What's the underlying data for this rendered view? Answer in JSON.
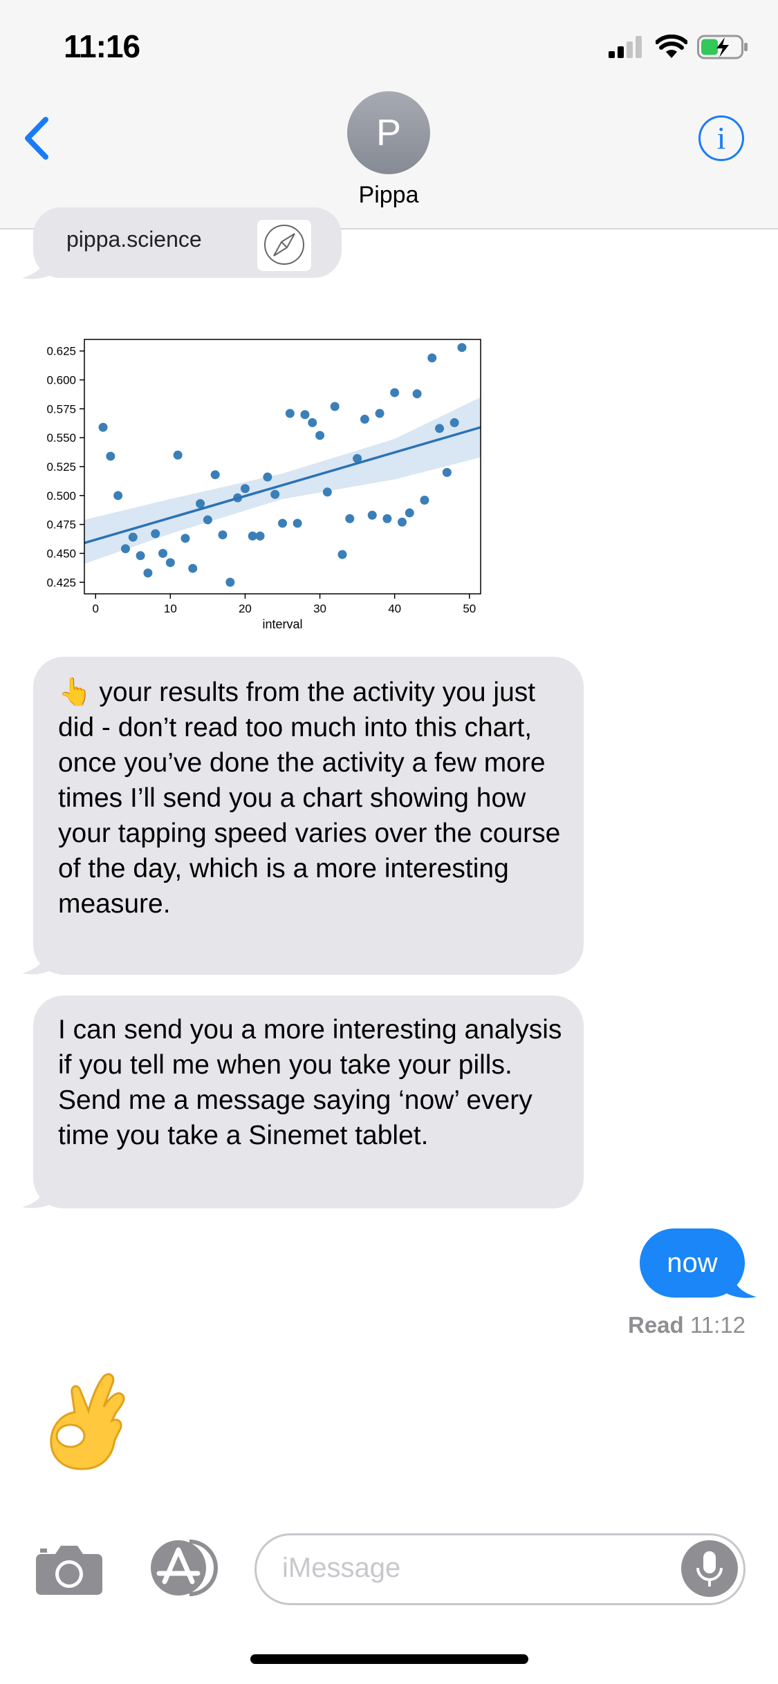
{
  "status_bar": {
    "time": "11:16"
  },
  "header": {
    "avatar_initial": "P",
    "contact_name": "Pippa",
    "info_symbol": "i"
  },
  "messages": {
    "link_preview_text": "pippa.science",
    "bubble1_text": "👆 your results from the activity you just did - don’t read too much into this chart, once you’ve done the activity a few more times I’ll send you a chart showing how your tapping speed varies over the course of the day, which is a more interesting measure.",
    "bubble2_text": "I can send you a more interesting analysis if you tell me when you take your pills. Send me a message saying ‘now’ every time you take a Sinemet tablet.",
    "sent_text": "now",
    "read_label": "Read",
    "read_time": "11:12"
  },
  "input_bar": {
    "placeholder": "iMessage"
  },
  "colors": {
    "imessage_blue": "#1a86f7",
    "received_bubble": "#e5e5ea",
    "chart_point": "#3a7fb8",
    "chart_ci": "#cfe0f0"
  },
  "chart_data": {
    "type": "scatter",
    "xlabel": "interval",
    "ylabel": "",
    "xlim": [
      -1.5,
      51.5
    ],
    "ylim": [
      0.415,
      0.635
    ],
    "xticks": [
      0,
      10,
      20,
      30,
      40,
      50
    ],
    "yticks": [
      0.425,
      0.45,
      0.475,
      0.5,
      0.525,
      0.55,
      0.575,
      0.6,
      0.625
    ],
    "ytick_labels": [
      "0.425",
      "0.450",
      "0.475",
      "0.500",
      "0.525",
      "0.550",
      "0.575",
      "0.600",
      "0.625"
    ],
    "points": [
      [
        1,
        0.559
      ],
      [
        2,
        0.534
      ],
      [
        3,
        0.5
      ],
      [
        4,
        0.454
      ],
      [
        5,
        0.464
      ],
      [
        6,
        0.448
      ],
      [
        7,
        0.433
      ],
      [
        8,
        0.467
      ],
      [
        9,
        0.45
      ],
      [
        10,
        0.442
      ],
      [
        11,
        0.535
      ],
      [
        12,
        0.463
      ],
      [
        13,
        0.437
      ],
      [
        14,
        0.493
      ],
      [
        15,
        0.479
      ],
      [
        16,
        0.518
      ],
      [
        17,
        0.466
      ],
      [
        18,
        0.425
      ],
      [
        19,
        0.498
      ],
      [
        20,
        0.506
      ],
      [
        21,
        0.465
      ],
      [
        22,
        0.465
      ],
      [
        23,
        0.516
      ],
      [
        24,
        0.501
      ],
      [
        25,
        0.476
      ],
      [
        26,
        0.571
      ],
      [
        27,
        0.476
      ],
      [
        28,
        0.57
      ],
      [
        29,
        0.563
      ],
      [
        30,
        0.552
      ],
      [
        31,
        0.503
      ],
      [
        32,
        0.577
      ],
      [
        33,
        0.449
      ],
      [
        34,
        0.48
      ],
      [
        35,
        0.532
      ],
      [
        36,
        0.566
      ],
      [
        37,
        0.483
      ],
      [
        38,
        0.571
      ],
      [
        39,
        0.48
      ],
      [
        40,
        0.589
      ],
      [
        41,
        0.477
      ],
      [
        42,
        0.485
      ],
      [
        43,
        0.588
      ],
      [
        44,
        0.496
      ],
      [
        45,
        0.619
      ],
      [
        46,
        0.558
      ],
      [
        47,
        0.52
      ],
      [
        48,
        0.563
      ],
      [
        49,
        0.628
      ]
    ],
    "regression": {
      "x0": -1.5,
      "y0": 0.459,
      "x1": 51.5,
      "y1": 0.559
    },
    "ci_band": {
      "x": [
        -1.5,
        10,
        25,
        40,
        51.5
      ],
      "upper": [
        0.479,
        0.497,
        0.519,
        0.549,
        0.585
      ],
      "lower": [
        0.441,
        0.467,
        0.497,
        0.514,
        0.533
      ]
    }
  }
}
